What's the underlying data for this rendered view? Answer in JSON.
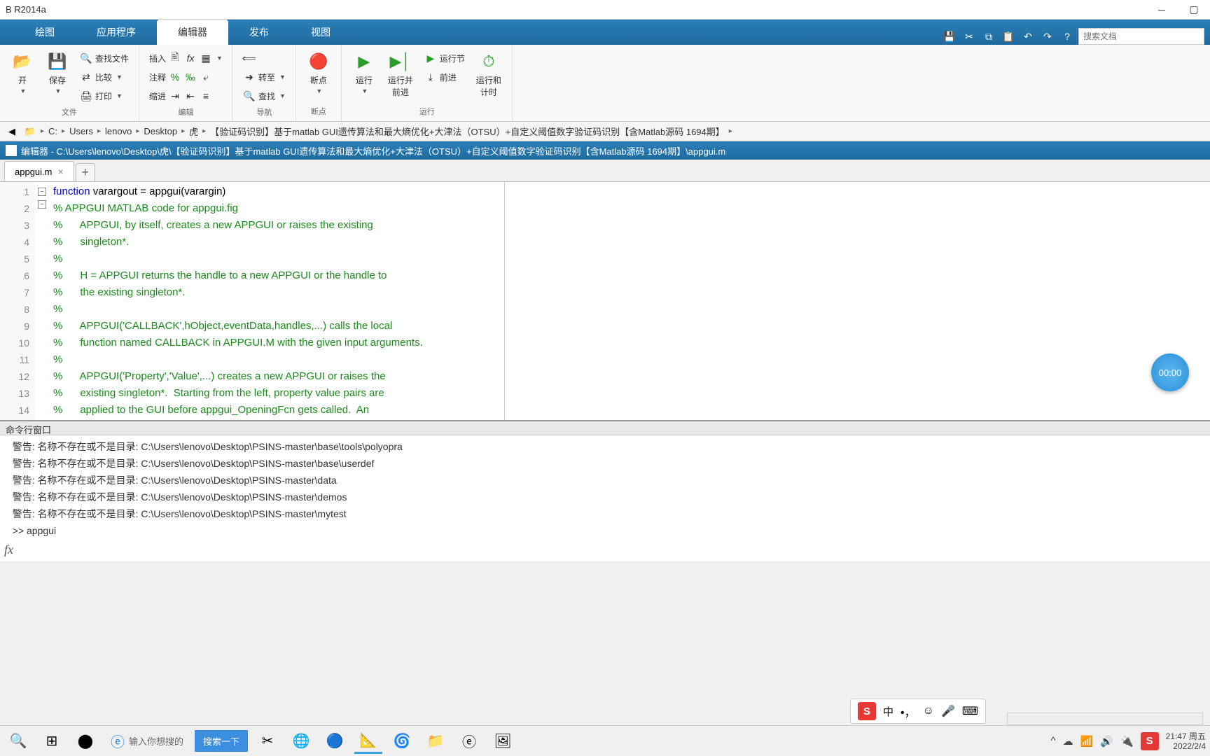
{
  "window": {
    "title": "B R2014a"
  },
  "main_tabs": [
    "绘图",
    "应用程序",
    "编辑器",
    "发布",
    "视图"
  ],
  "active_tab_index": 2,
  "search_docs_placeholder": "搜索文档",
  "ribbon": {
    "file": {
      "label": "文件",
      "open": "开",
      "save": "保存",
      "findfiles": "查找文件",
      "compare": "比较",
      "print": "打印"
    },
    "edit": {
      "label": "编辑",
      "insert": "插入",
      "comment": "注释",
      "indent": "缩进"
    },
    "nav": {
      "label": "导航",
      "goto": "转至",
      "find": "查找"
    },
    "bp": {
      "label": "断点",
      "btn": "断点"
    },
    "run": {
      "label": "运行",
      "run": "运行",
      "run_advance": "运行并\n前进",
      "run_section": "运行节",
      "advance": "前进",
      "run_time": "运行和\n计时"
    }
  },
  "breadcrumb": [
    "C:",
    "Users",
    "lenovo",
    "Desktop",
    "虎",
    "【验证码识别】基于matlab GUI遗传算法和最大熵优化+大津法（OTSU）+自定义阈值数字验证码识别【含Matlab源码 1694期】"
  ],
  "editor_title": "编辑器 - C:\\Users\\lenovo\\Desktop\\虎\\【验证码识别】基于matlab GUI遗传算法和最大熵优化+大津法（OTSU）+自定义阈值数字验证码识别【含Matlab源码 1694期】\\appgui.m",
  "file_tab": "appgui.m",
  "code_lines": [
    {
      "n": 1,
      "t": "function",
      "s": " varargout = appgui(varargin)",
      "cls": "kw"
    },
    {
      "n": 2,
      "t": "% APPGUI MATLAB code for appgui.fig",
      "cls": "cm"
    },
    {
      "n": 3,
      "t": "%      APPGUI, by itself, creates a new APPGUI or raises the existing",
      "cls": "cm"
    },
    {
      "n": 4,
      "t": "%      singleton*.",
      "cls": "cm"
    },
    {
      "n": 5,
      "t": "%",
      "cls": "cm"
    },
    {
      "n": 6,
      "t": "%      H = APPGUI returns the handle to a new APPGUI or the handle to",
      "cls": "cm"
    },
    {
      "n": 7,
      "t": "%      the existing singleton*.",
      "cls": "cm"
    },
    {
      "n": 8,
      "t": "%",
      "cls": "cm"
    },
    {
      "n": 9,
      "t": "%      APPGUI('CALLBACK',hObject,eventData,handles,...) calls the local",
      "cls": "cm"
    },
    {
      "n": 10,
      "t": "%      function named CALLBACK in APPGUI.M with the given input arguments.",
      "cls": "cm"
    },
    {
      "n": 11,
      "t": "%",
      "cls": "cm"
    },
    {
      "n": 12,
      "t": "%      APPGUI('Property','Value',...) creates a new APPGUI or raises the",
      "cls": "cm"
    },
    {
      "n": 13,
      "t": "%      existing singleton*.  Starting from the left, property value pairs are",
      "cls": "cm"
    },
    {
      "n": 14,
      "t": "%      applied to the GUI before appgui_OpeningFcn gets called.  An",
      "cls": "cm"
    }
  ],
  "cmd_title": "命令行窗口",
  "cmd_lines": [
    "警告: 名称不存在或不是目录: C:\\Users\\lenovo\\Desktop\\PSINS-master\\base\\tools\\polyopra",
    "警告: 名称不存在或不是目录: C:\\Users\\lenovo\\Desktop\\PSINS-master\\base\\userdef",
    "警告: 名称不存在或不是目录: C:\\Users\\lenovo\\Desktop\\PSINS-master\\data",
    "警告: 名称不存在或不是目录: C:\\Users\\lenovo\\Desktop\\PSINS-master\\demos",
    "警告: 名称不存在或不是目录: C:\\Users\\lenovo\\Desktop\\PSINS-master\\mytest",
    ">> appgui"
  ],
  "timer": "00:00",
  "taskbar": {
    "search_placeholder": "输入你想搜的",
    "search_btn": "搜索一下",
    "ime_char": "S",
    "ime_lang": "中",
    "time": "21:47 周五",
    "date": "2022/2/4"
  }
}
